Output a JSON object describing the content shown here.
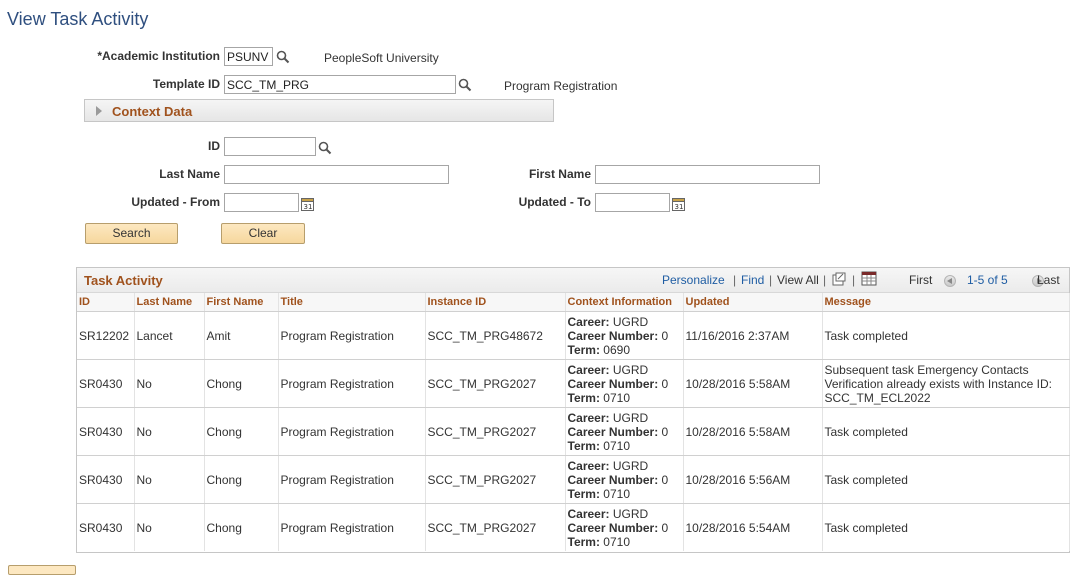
{
  "page": {
    "title": "View Task Activity"
  },
  "form": {
    "institution": {
      "label": "*Academic Institution",
      "value": "PSUNV",
      "description": "PeopleSoft University"
    },
    "template": {
      "label": "Template ID",
      "value": "SCC_TM_PRG",
      "description": "Program Registration"
    },
    "context_data": {
      "label": "Context Data"
    },
    "id": {
      "label": "ID",
      "value": ""
    },
    "last_name": {
      "label": "Last Name",
      "value": ""
    },
    "first_name": {
      "label": "First Name",
      "value": ""
    },
    "updated_from": {
      "label": "Updated - From",
      "value": ""
    },
    "updated_to": {
      "label": "Updated - To",
      "value": ""
    },
    "search_label": "Search",
    "clear_label": "Clear"
  },
  "grid": {
    "title": "Task Activity",
    "personalize": "Personalize",
    "find": "Find",
    "view_all": "View All",
    "first": "First",
    "range": "1-5 of 5",
    "last": "Last",
    "columns": [
      "ID",
      "Last Name",
      "First Name",
      "Title",
      "Instance ID",
      "Context Information",
      "Updated",
      "Message"
    ],
    "context_labels": {
      "career": "Career:",
      "career_number": "Career Number:",
      "term": "Term:"
    },
    "rows": [
      {
        "id": "SR12202",
        "last_name": "Lancet",
        "first_name": "Amit",
        "title": "Program Registration",
        "instance_id": "SCC_TM_PRG48672",
        "career": "UGRD",
        "career_number": "0",
        "term": "0690",
        "updated": "11/16/2016  2:37AM",
        "message": "Task completed"
      },
      {
        "id": "SR0430",
        "last_name": "No",
        "first_name": "Chong",
        "title": "Program Registration",
        "instance_id": "SCC_TM_PRG2027",
        "career": "UGRD",
        "career_number": "0",
        "term": "0710",
        "updated": "10/28/2016  5:58AM",
        "message": "Subsequent task Emergency Contacts Verification already exists with Instance ID: SCC_TM_ECL2022"
      },
      {
        "id": "SR0430",
        "last_name": "No",
        "first_name": "Chong",
        "title": "Program Registration",
        "instance_id": "SCC_TM_PRG2027",
        "career": "UGRD",
        "career_number": "0",
        "term": "0710",
        "updated": "10/28/2016  5:58AM",
        "message": "Task completed"
      },
      {
        "id": "SR0430",
        "last_name": "No",
        "first_name": "Chong",
        "title": "Program Registration",
        "instance_id": "SCC_TM_PRG2027",
        "career": "UGRD",
        "career_number": "0",
        "term": "0710",
        "updated": "10/28/2016  5:56AM",
        "message": "Task completed"
      },
      {
        "id": "SR0430",
        "last_name": "No",
        "first_name": "Chong",
        "title": "Program Registration",
        "instance_id": "SCC_TM_PRG2027",
        "career": "UGRD",
        "career_number": "0",
        "term": "0710",
        "updated": "10/28/2016  5:54AM",
        "message": "Task completed"
      }
    ]
  }
}
